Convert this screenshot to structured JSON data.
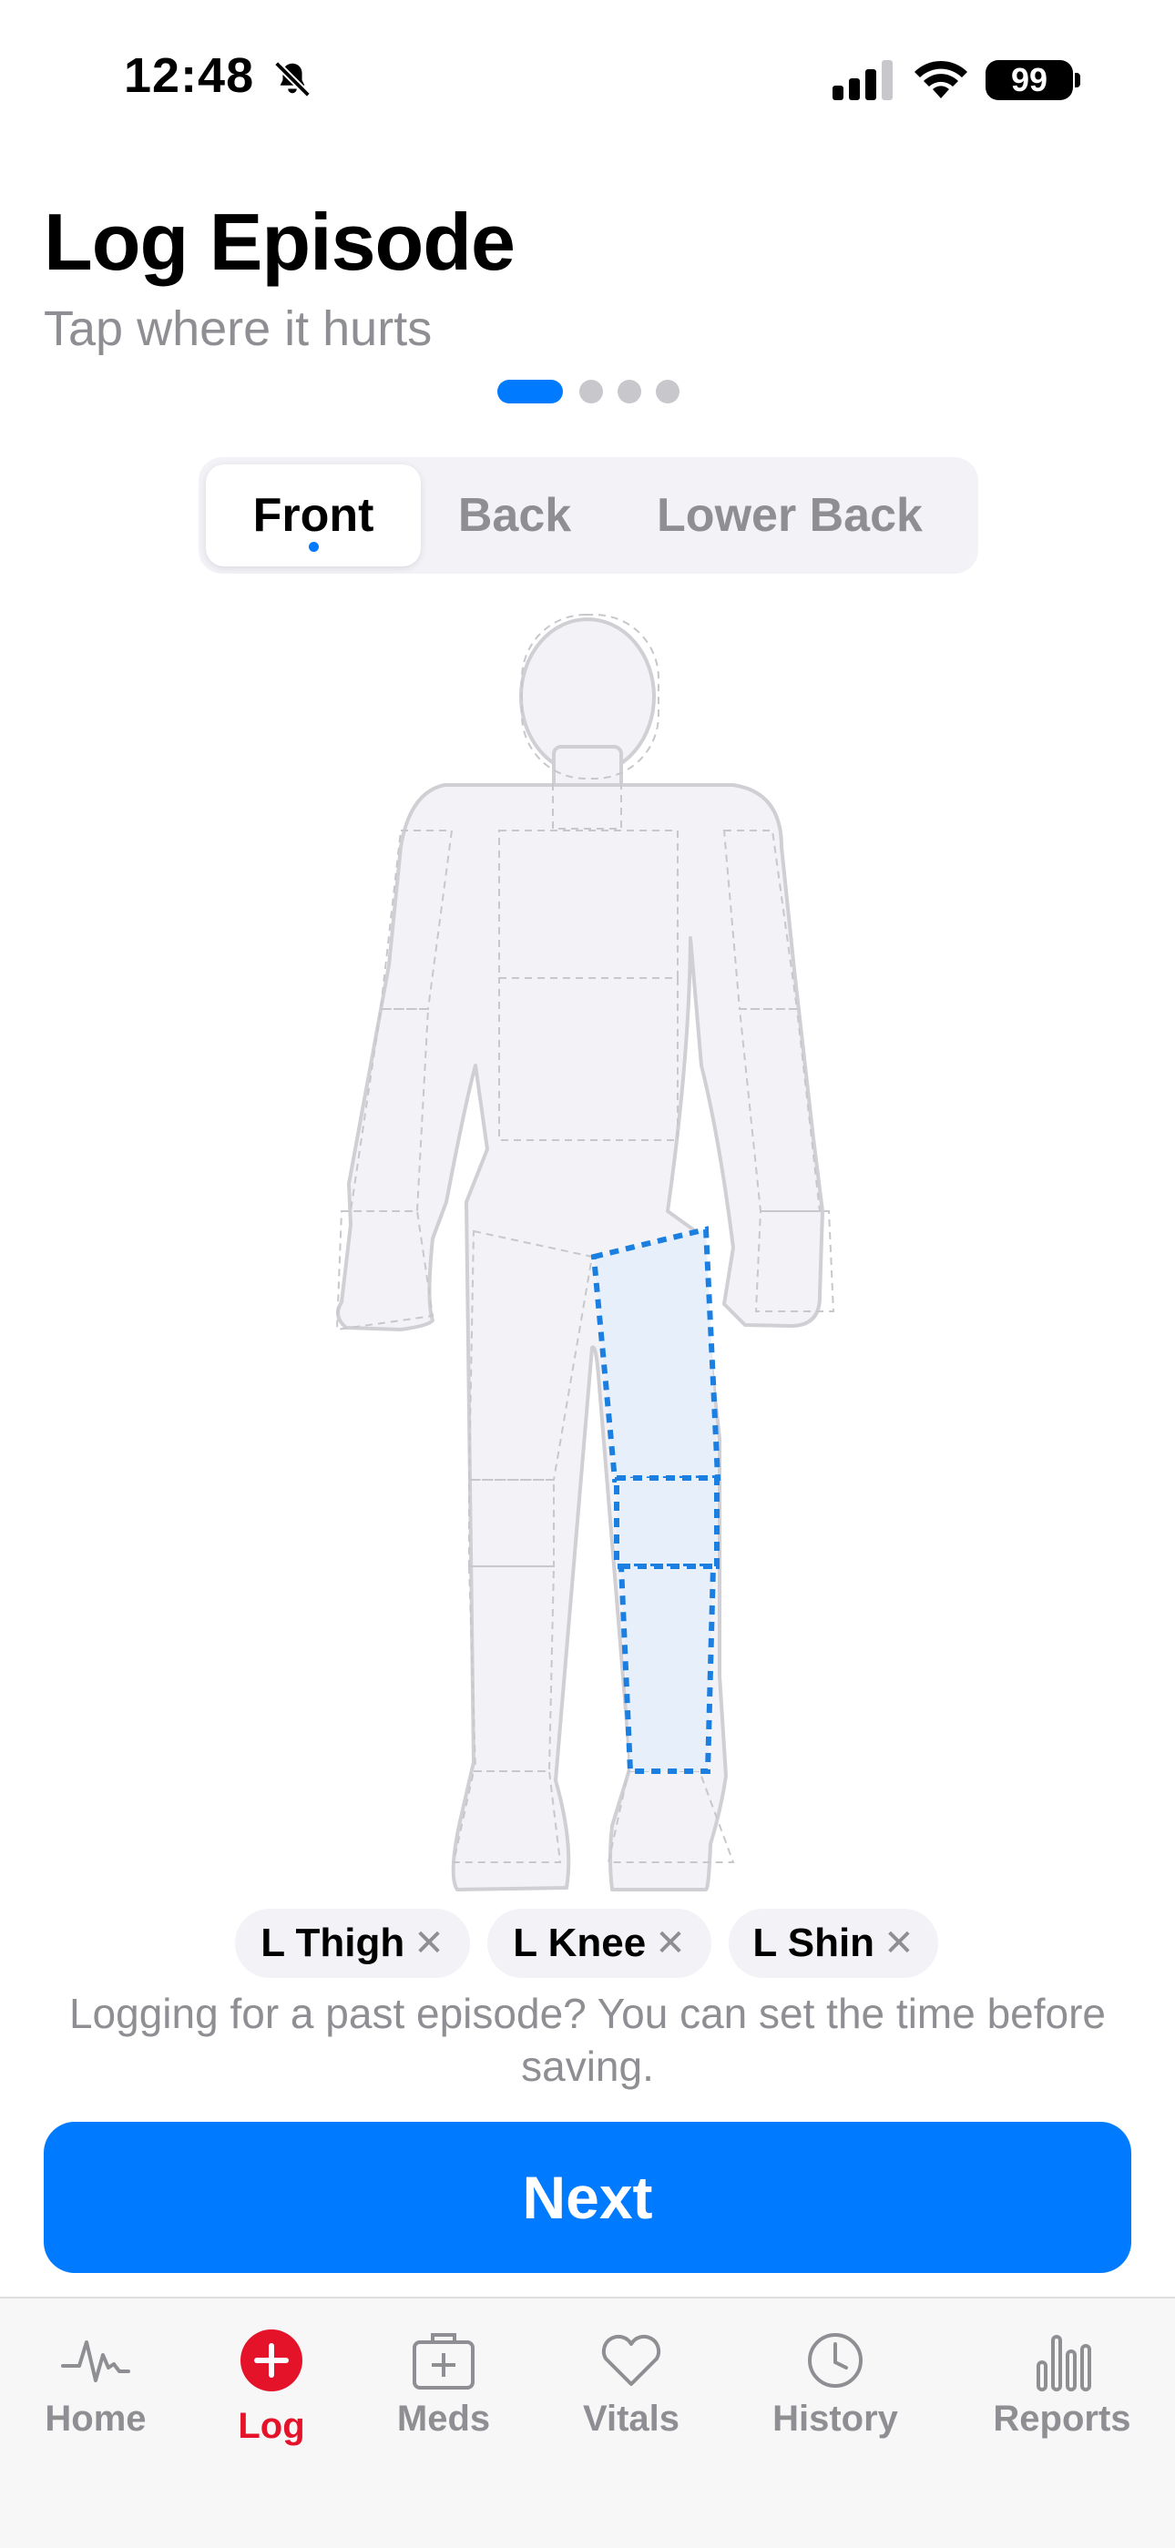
{
  "status_bar": {
    "time": "12:48",
    "battery": "99"
  },
  "header": {
    "title": "Log Episode",
    "subtitle": "Tap where it hurts"
  },
  "steps": {
    "count": 4,
    "current": 1
  },
  "view_tabs": [
    {
      "label": "Front",
      "active": true
    },
    {
      "label": "Back",
      "active": false
    },
    {
      "label": "Lower Back",
      "active": false
    }
  ],
  "body_map": {
    "selected_regions": [
      "L Thigh",
      "L Knee",
      "L Shin"
    ]
  },
  "chips": [
    {
      "label": "L Thigh"
    },
    {
      "label": "L Knee"
    },
    {
      "label": "L Shin"
    }
  ],
  "hint": "Logging for a past episode? You can set the time before saving.",
  "next_button": "Next",
  "tab_bar": [
    {
      "label": "Home",
      "icon": "pulse-icon",
      "active": false
    },
    {
      "label": "Log",
      "icon": "plus-circle-icon",
      "active": true
    },
    {
      "label": "Meds",
      "icon": "medkit-icon",
      "active": false
    },
    {
      "label": "Vitals",
      "icon": "heart-icon",
      "active": false
    },
    {
      "label": "History",
      "icon": "clock-icon",
      "active": false
    },
    {
      "label": "Reports",
      "icon": "bar-chart-icon",
      "active": false
    }
  ],
  "colors": {
    "accent": "#007aff",
    "active_tab": "#e5132a",
    "selected_region_fill": "#e7effb",
    "selected_region_stroke": "#1a7fe0"
  }
}
